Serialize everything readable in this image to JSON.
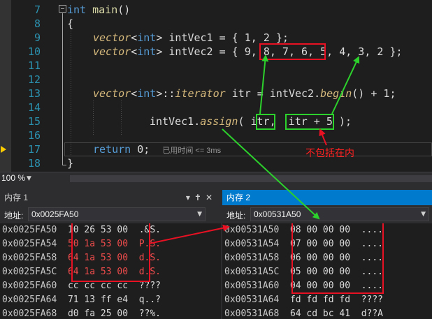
{
  "editor": {
    "line_numbers": [
      "7",
      "8",
      "9",
      "10",
      "11",
      "12",
      "13",
      "14",
      "15",
      "16",
      "17",
      "18"
    ],
    "l7": {
      "kw": "int",
      "fn": "main",
      "rest": "()"
    },
    "l8": {
      "text": "{"
    },
    "l9": {
      "vec": "vector",
      "lt": "<",
      "kw": "int",
      "gt": "> ",
      "var": "intVec1",
      "rest": " = { 1, 2 };"
    },
    "l10": {
      "vec": "vector",
      "lt": "<",
      "kw": "int",
      "gt": "> ",
      "var": "intVec2",
      "rest": " = { 9, 8, 7, 6, 5, 4, 3, 2 };"
    },
    "l13": {
      "vec": "vector",
      "lt": "<",
      "kw": "int",
      "gt": ">::",
      "iter": "iterator",
      "mid": " itr = intVec2.",
      "call": "begin",
      "rest": "() + 1;"
    },
    "l15": {
      "var": "intVec1.",
      "call": "assign",
      "rest": "( itr,  itr + 5 );"
    },
    "l17": {
      "kw": "return",
      "rest": " 0;",
      "elapsed": "已用时间 <= 3ms"
    },
    "l18": {
      "text": "}"
    }
  },
  "zoom": {
    "label": "100 %"
  },
  "annotation": {
    "note": "不包括在内"
  },
  "memory1": {
    "title": "内存 1",
    "addr_label": "地址:",
    "addr_value": "0x0025FA50",
    "rows": [
      {
        "addr": "0x0025FA50",
        "bytes": "10 26 53 00",
        "ascii": ".&S."
      },
      {
        "addr": "0x0025FA54",
        "bytes": "50 1a 53 00",
        "ascii": "P.S."
      },
      {
        "addr": "0x0025FA58",
        "bytes": "64 1a 53 00",
        "ascii": "d.S."
      },
      {
        "addr": "0x0025FA5C",
        "bytes": "64 1a 53 00",
        "ascii": "d.S."
      },
      {
        "addr": "0x0025FA60",
        "bytes": "cc cc cc cc",
        "ascii": "????"
      },
      {
        "addr": "0x0025FA64",
        "bytes": "71 13 ff e4",
        "ascii": "q..?"
      },
      {
        "addr": "0x0025FA68",
        "bytes": "d0 fa 25 00",
        "ascii": "??%."
      }
    ]
  },
  "memory2": {
    "title": "内存 2",
    "addr_label": "地址:",
    "addr_value": "0x00531A50",
    "rows": [
      {
        "addr": "0x00531A50",
        "bytes": "08 00 00 00",
        "ascii": "...."
      },
      {
        "addr": "0x00531A54",
        "bytes": "07 00 00 00",
        "ascii": "...."
      },
      {
        "addr": "0x00531A58",
        "bytes": "06 00 00 00",
        "ascii": "...."
      },
      {
        "addr": "0x00531A5C",
        "bytes": "05 00 00 00",
        "ascii": "...."
      },
      {
        "addr": "0x00531A60",
        "bytes": "04 00 00 00",
        "ascii": "...."
      },
      {
        "addr": "0x00531A64",
        "bytes": "fd fd fd fd",
        "ascii": "????"
      },
      {
        "addr": "0x00531A68",
        "bytes": "64 cd bc 41",
        "ascii": "d??A"
      }
    ]
  },
  "colors": {
    "highlight_red": "#e81123",
    "highlight_green": "#2cd12c",
    "active_tab": "#007acc"
  }
}
